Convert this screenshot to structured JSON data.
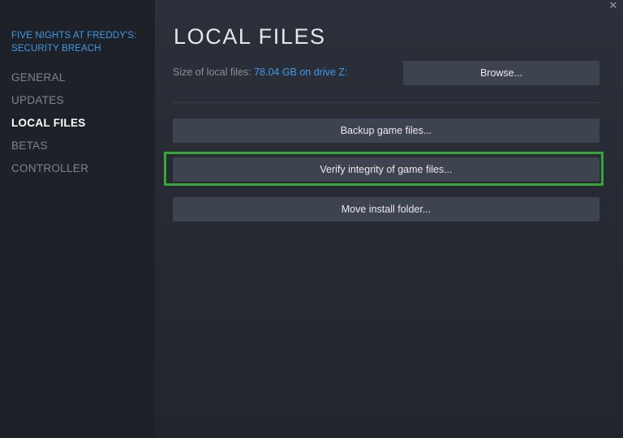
{
  "window": {
    "close_icon": "✕"
  },
  "sidebar": {
    "game_title": "FIVE NIGHTS AT FREDDY'S: SECURITY BREACH",
    "items": [
      {
        "label": "GENERAL",
        "active": false
      },
      {
        "label": "UPDATES",
        "active": false
      },
      {
        "label": "LOCAL FILES",
        "active": true
      },
      {
        "label": "BETAS",
        "active": false
      },
      {
        "label": "CONTROLLER",
        "active": false
      }
    ]
  },
  "main": {
    "title": "LOCAL FILES",
    "size_label": "Size of local files:",
    "size_value": "78.04 GB on drive Z:",
    "browse_label": "Browse...",
    "backup_label": "Backup game files...",
    "verify_label": "Verify integrity of game files...",
    "move_label": "Move install folder..."
  },
  "colors": {
    "accent_blue": "#3e9be8",
    "highlight_green": "#34a736",
    "button_bg": "#3e4350"
  }
}
